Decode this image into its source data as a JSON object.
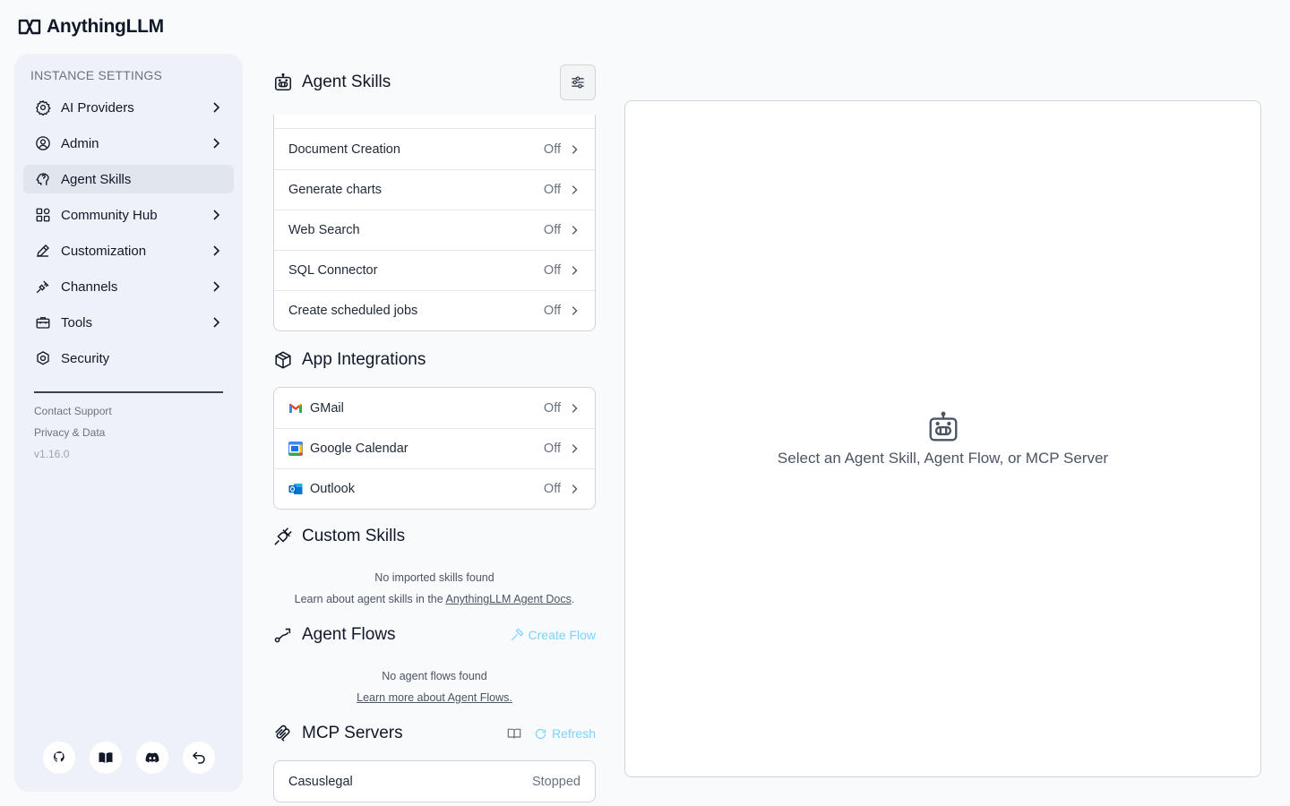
{
  "app": {
    "title": "AnythingLLM"
  },
  "sidebar": {
    "heading": "INSTANCE SETTINGS",
    "items": [
      {
        "label": "AI Providers",
        "icon": "gear-icon",
        "chevron": true,
        "active": false
      },
      {
        "label": "Admin",
        "icon": "user-gear-icon",
        "chevron": true,
        "active": false
      },
      {
        "label": "Agent Skills",
        "icon": "brain-icon",
        "chevron": false,
        "active": true
      },
      {
        "label": "Community Hub",
        "icon": "grid-icon",
        "chevron": true,
        "active": false
      },
      {
        "label": "Customization",
        "icon": "pencil-icon",
        "chevron": true,
        "active": false
      },
      {
        "label": "Channels",
        "icon": "plug-icon",
        "chevron": true,
        "active": false
      },
      {
        "label": "Tools",
        "icon": "toolbox-icon",
        "chevron": true,
        "active": false
      },
      {
        "label": "Security",
        "icon": "shield-icon",
        "chevron": false,
        "active": false
      }
    ],
    "footer": {
      "contact_support": "Contact Support",
      "privacy": "Privacy & Data",
      "version": "v1.16.0"
    },
    "bottom_buttons": [
      "github-icon",
      "book-icon",
      "discord-icon",
      "return-icon"
    ]
  },
  "agent_skills": {
    "title": "Agent Skills",
    "skills": [
      {
        "label": "Document Creation",
        "status": "Off"
      },
      {
        "label": "Generate charts",
        "status": "Off"
      },
      {
        "label": "Web Search",
        "status": "Off"
      },
      {
        "label": "SQL Connector",
        "status": "Off"
      },
      {
        "label": "Create scheduled jobs",
        "status": "Off"
      }
    ]
  },
  "app_integrations": {
    "title": "App Integrations",
    "apps": [
      {
        "label": "GMail",
        "status": "Off",
        "icon": "gmail-icon"
      },
      {
        "label": "Google Calendar",
        "status": "Off",
        "icon": "google-calendar-icon"
      },
      {
        "label": "Outlook",
        "status": "Off",
        "icon": "outlook-icon"
      }
    ]
  },
  "custom_skills": {
    "title": "Custom Skills",
    "empty": "No imported skills found",
    "learn_prefix": "Learn about agent skills in the ",
    "learn_link": "AnythingLLM Agent Docs",
    "learn_suffix": "."
  },
  "agent_flows": {
    "title": "Agent Flows",
    "create": "Create Flow",
    "empty": "No agent flows found",
    "learn_link": "Learn more about Agent Flows."
  },
  "mcp_servers": {
    "title": "MCP Servers",
    "refresh": "Refresh",
    "servers": [
      {
        "label": "Casuslegal",
        "status": "Stopped"
      }
    ]
  },
  "panel": {
    "placeholder": "Select an Agent Skill, Agent Flow, or MCP Server"
  },
  "colors": {
    "accent": "#7dd3fc",
    "sidebar_bg": "#eef2f8",
    "active_item": "#e1e6ee"
  }
}
